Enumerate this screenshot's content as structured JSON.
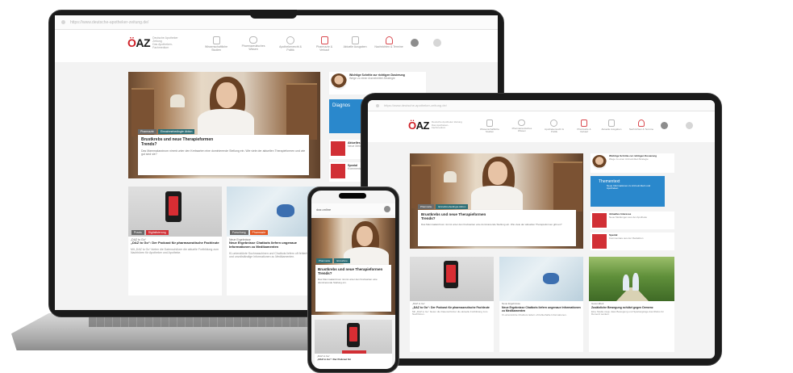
{
  "desktop": {
    "url": "https://www.deutsche-apotheker-zeitung.de/",
    "logo": {
      "mark_prefix": "Ö",
      "mark_rest": "AZ",
      "subtitle_line1": "Deutsche Apotheker Zeitung",
      "subtitle_line2": "Das Apotheken-Fachmedium"
    },
    "nav": [
      {
        "label": "Wissenschaftliche Studien",
        "icon": "document-icon"
      },
      {
        "label": "Pharmazeutisches Wissen",
        "icon": "chat-icon"
      },
      {
        "label": "Apothekenrecht & Politik",
        "icon": "people-icon"
      },
      {
        "label": "Pharmazie & Verkauf",
        "icon": "box-icon"
      },
      {
        "label": "Aktuelle Ausgaben",
        "icon": "newspaper-icon"
      },
      {
        "label": "Nachrichten & Termine",
        "icon": "radio-icon"
      }
    ],
    "hero": {
      "tags": [
        "Pharmazie",
        "Einnahmebedingte Aktion"
      ],
      "title": "Brustkrebs und neue Therapieformen",
      "subtitle": "Trends?",
      "text": "Das Mammakarzinom nimmt unter den Krebsarten eine dominierende Stellung ein. Wie viele der aktuellen Therapieformen und wie gut sind sie?"
    },
    "side": {
      "author_title": "Wichtige Schritte zur richtigen Dosierung",
      "author_sub": "Wege zu einer Arzneimittel-Strategie",
      "banner": "Diagnos",
      "items": [
        {
          "title": "Aktuelles",
          "sub": "Neue Meldungen"
        },
        {
          "title": "Spezial",
          "sub": "Kommentare"
        }
      ]
    },
    "cards": [
      {
        "tags": [
          "Praxis",
          "Digitalisierung"
        ],
        "kicker": "„DAZ to Go“",
        "title": "„DAZ to Go“: Der Podcast für pharmazeutische Fachleute",
        "text": "Mit „DAZ to Go“ bieten die Datenschützer die aktuelle Fortbildung zum Nachhören für Apotheker und Apotheke."
      },
      {
        "tags": [
          "Forschung",
          "Pharmazie"
        ],
        "kicker": "Neue Ergebnisse",
        "title": "Neue Ergebnisse Chatbots liefern ungenaue Informationen zu Medikamenten",
        "text": "KI-unterstützte Suchmaschinen und Chatbots liefern oft fehlerhafte und unvollständige Informationen zu Medikamenten."
      }
    ]
  },
  "tablet": {
    "url": "https://www.deutsche-apotheker-zeitung.de/",
    "hero": {
      "title": "Brustkrebs und neue Therapieformen",
      "subtitle": "Trends?",
      "text": "Das Mammakarzinom nimmt unter den Krebsarten eine dominierende Stellung ein. Wie viele der aktuellen Therapieformen gibt es?"
    },
    "side": {
      "author_title": "Wichtige Schritte zur richtigen Dosierung",
      "author_sub": "Wege zu einer Arzneimittel-Strategie",
      "banner_title": "Thementext",
      "banner_sub": "Neue Informationen zu Arzneimitteln und Apotheken",
      "items": [
        {
          "title": "Aktuelles Interesse",
          "sub": "Neue Meldungen aus der Apotheke"
        },
        {
          "title": "Spezial",
          "sub": "Kommentare aus der Redaktion"
        }
      ]
    },
    "cards": [
      {
        "kicker": "„DAZ to Go“",
        "title": "„DAZ to Go“: Der Podcast für pharmazeutische Fachleute",
        "text": "Mit „DAZ to Go“ bieten die Datenschützer die aktuelle Fortbildung zum Nachhören."
      },
      {
        "kicker": "Neue Ergebnisse",
        "title": "Neue Ergebnisse Chatbots liefern ungenaue Informationen zu Medikamenten",
        "text": "KI-unterstützte Chatbots liefern oft fehlerhafte Informationen."
      },
      {
        "kicker": "Gesundheit",
        "title": "Zusätzliche Bewegung schützt gegen Demenz",
        "text": "Eine Studie zeigt, dass Bewegung und Spaziergänge das Risiko für Demenz senken."
      }
    ]
  },
  "phone": {
    "url": "daz.online",
    "hero": {
      "tags": [
        "Pharmazie",
        "Einnahme"
      ],
      "title": "Brustkrebs und neue Therapieformen",
      "subtitle": "Trends?",
      "text": "Das Mammakarzinom nimmt unter den Krebsarten eine dominierende Stellung ein."
    },
    "card": {
      "kicker": "„DAZ to Go“",
      "title": "„DAZ to Go“: Der Podcast für"
    }
  }
}
